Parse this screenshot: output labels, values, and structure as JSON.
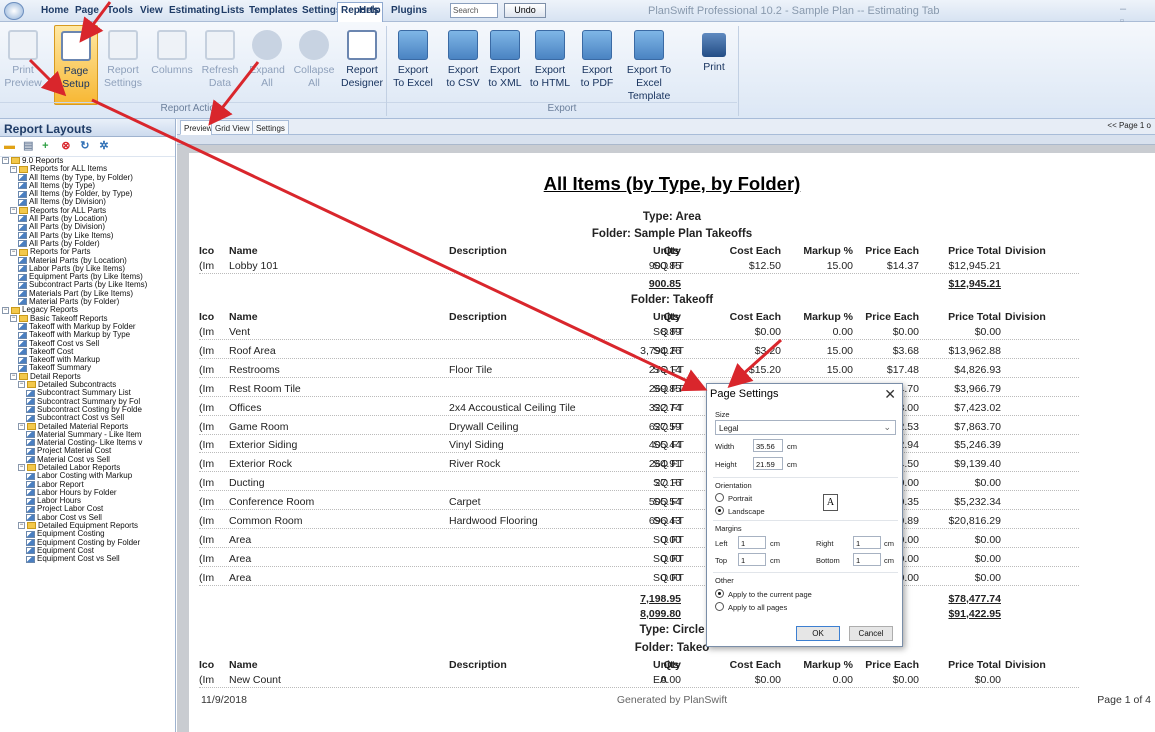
{
  "app": {
    "title": "PlanSwift Professional 10.2 - Sample Plan -- Estimating Tab",
    "search_placeholder": "Search",
    "undo": "Undo",
    "menus": [
      "Home",
      "Page",
      "Tools",
      "View",
      "Estimating",
      "Lists",
      "Templates",
      "Settings",
      "Reports",
      "Help",
      "Plugins"
    ],
    "active_menu": "Reports"
  },
  "ribbon": {
    "buttons": [
      {
        "l1": "Print",
        "l2": "Preview",
        "state": "disabled"
      },
      {
        "l1": "Page",
        "l2": "Setup",
        "state": "selected"
      },
      {
        "l1": "Report",
        "l2": "Settings",
        "state": "disabled"
      },
      {
        "l1": "Columns",
        "l2": "",
        "state": "disabled"
      },
      {
        "l1": "Refresh",
        "l2": "Data",
        "state": "disabled"
      },
      {
        "l1": "Expand",
        "l2": "All",
        "state": "disabled"
      },
      {
        "l1": "Collapse",
        "l2": "All",
        "state": "disabled"
      },
      {
        "l1": "Report",
        "l2": "Designer",
        "state": "enabled"
      },
      {
        "l1": "Export",
        "l2": "To Excel",
        "state": "enabled"
      },
      {
        "l1": "Export",
        "l2": "to CSV",
        "state": "enabled"
      },
      {
        "l1": "Export",
        "l2": "to XML",
        "state": "enabled"
      },
      {
        "l1": "Export",
        "l2": "to HTML",
        "state": "enabled"
      },
      {
        "l1": "Export",
        "l2": "to PDF",
        "state": "enabled"
      },
      {
        "l1": "Export To",
        "l2": "Excel Template",
        "state": "enabled"
      },
      {
        "l1": "Print",
        "l2": "",
        "state": "enabled"
      }
    ],
    "groups": {
      "actions": "Report Actions",
      "export": "Export"
    }
  },
  "left_panel": {
    "title": "Report Layouts",
    "tree": [
      {
        "t": "9.0 Reports",
        "d": 0,
        "k": "root"
      },
      {
        "t": "Reports for ALL Items",
        "d": 1,
        "k": "folder"
      },
      {
        "t": "All Items (by Type, by Folder)",
        "d": 2,
        "k": "rep"
      },
      {
        "t": "All Items (by Type)",
        "d": 2,
        "k": "rep"
      },
      {
        "t": "All Items (by Folder, by Type)",
        "d": 2,
        "k": "rep"
      },
      {
        "t": "All Items (by Division)",
        "d": 2,
        "k": "rep"
      },
      {
        "t": "Reports for ALL Parts",
        "d": 1,
        "k": "folder"
      },
      {
        "t": "All Parts (by Location)",
        "d": 2,
        "k": "rep"
      },
      {
        "t": "All Parts (by Division)",
        "d": 2,
        "k": "rep"
      },
      {
        "t": "All Parts (by Like Items)",
        "d": 2,
        "k": "rep"
      },
      {
        "t": "All Parts (by Folder)",
        "d": 2,
        "k": "rep"
      },
      {
        "t": "Reports for Parts",
        "d": 1,
        "k": "folder"
      },
      {
        "t": "Material Parts (by Location)",
        "d": 2,
        "k": "rep"
      },
      {
        "t": "Labor Parts (by Like Items)",
        "d": 2,
        "k": "rep"
      },
      {
        "t": "Equipment Parts (by Like Items)",
        "d": 2,
        "k": "rep"
      },
      {
        "t": "Subcontract Parts (by Like Items)",
        "d": 2,
        "k": "rep"
      },
      {
        "t": "Materials Part (by Like Items)",
        "d": 2,
        "k": "rep"
      },
      {
        "t": "Material Parts (by Folder)",
        "d": 2,
        "k": "rep"
      },
      {
        "t": "Legacy Reports",
        "d": 0,
        "k": "root"
      },
      {
        "t": "Basic Takeoff Reports",
        "d": 1,
        "k": "folder"
      },
      {
        "t": "Takeoff with Markup by Folder",
        "d": 2,
        "k": "rep"
      },
      {
        "t": "Takeoff with Markup by Type",
        "d": 2,
        "k": "rep"
      },
      {
        "t": "Takeoff Cost vs Sell",
        "d": 2,
        "k": "rep"
      },
      {
        "t": "Takeoff Cost",
        "d": 2,
        "k": "rep"
      },
      {
        "t": "Takeoff with Markup",
        "d": 2,
        "k": "rep"
      },
      {
        "t": "Takeoff Summary",
        "d": 2,
        "k": "rep"
      },
      {
        "t": "Detail Reports",
        "d": 1,
        "k": "folder"
      },
      {
        "t": "Detailed Subcontracts",
        "d": 2,
        "k": "folder"
      },
      {
        "t": "Subcontract Summary List",
        "d": 3,
        "k": "rep"
      },
      {
        "t": "Subcontract Summary by Fol",
        "d": 3,
        "k": "rep"
      },
      {
        "t": "Subcontract Costing by Folde",
        "d": 3,
        "k": "rep"
      },
      {
        "t": "Subcontract Cost vs Sell",
        "d": 3,
        "k": "rep"
      },
      {
        "t": "Detailed Material Reports",
        "d": 2,
        "k": "folder"
      },
      {
        "t": "Material Summary - Like Item",
        "d": 3,
        "k": "rep"
      },
      {
        "t": "Material Costing- Like Items v",
        "d": 3,
        "k": "rep"
      },
      {
        "t": "Project Material Cost",
        "d": 3,
        "k": "rep"
      },
      {
        "t": "Material Cost vs Sell",
        "d": 3,
        "k": "rep"
      },
      {
        "t": "Detailed Labor Reports",
        "d": 2,
        "k": "folder"
      },
      {
        "t": "Labor Costing with Markup",
        "d": 3,
        "k": "rep"
      },
      {
        "t": "Labor Report",
        "d": 3,
        "k": "rep"
      },
      {
        "t": "Labor Hours by Folder",
        "d": 3,
        "k": "rep"
      },
      {
        "t": "Labor Hours",
        "d": 3,
        "k": "rep"
      },
      {
        "t": "Project Labor Cost",
        "d": 3,
        "k": "rep"
      },
      {
        "t": "Labor Cost vs Sell",
        "d": 3,
        "k": "rep"
      },
      {
        "t": "Detailed Equipment Reports",
        "d": 2,
        "k": "folder"
      },
      {
        "t": "Equipment Costing",
        "d": 3,
        "k": "rep"
      },
      {
        "t": "Equipment Costing by Folder",
        "d": 3,
        "k": "rep"
      },
      {
        "t": "Equipment Cost",
        "d": 3,
        "k": "rep"
      },
      {
        "t": "Equipment Cost vs Sell",
        "d": 3,
        "k": "rep"
      }
    ]
  },
  "tabs": {
    "preview": "Preview",
    "grid": "Grid View",
    "settings": "Settings",
    "pager": "<<  Page 1 o"
  },
  "report": {
    "title": "All Items (by Type, by Folder)",
    "headers": [
      "Ico",
      "Name",
      "Description",
      "Qty",
      "Units",
      "Cost Each",
      "Markup %",
      "Price Each",
      "Price Total",
      "Division"
    ],
    "area_type": "Type: Area",
    "folder1": "Folder: Sample Plan Takeoffs",
    "rows1": [
      [
        "(Im",
        "Lobby 101",
        "",
        "900.85",
        "SQ FT",
        "$12.50",
        "15.00",
        "$14.37",
        "$12,945.21"
      ]
    ],
    "total1": "900.85",
    "total1_price": "$12,945.21",
    "folder2": "Folder: Takeoff",
    "rows2": [
      [
        "(Im",
        "Vent",
        "",
        "8.89",
        "SQ FT",
        "$0.00",
        "0.00",
        "$0.00",
        "$0.00"
      ],
      [
        "(Im",
        "Roof Area",
        "",
        "3,794.26",
        "SQ FT",
        "$3.20",
        "15.00",
        "$3.68",
        "$13,962.88"
      ],
      [
        "(Im",
        "Restrooms",
        "Floor Tile",
        "276.14",
        "SQ FT",
        "$15.20",
        "15.00",
        "$17.48",
        "$4,826.93"
      ],
      [
        "(Im",
        "Rest Room Tile",
        "",
        "269.85",
        "SQ FT",
        "",
        "",
        "$14.70",
        "$3,966.79"
      ],
      [
        "(Im",
        "Offices",
        "2x4 Accoustical Ceiling Tile",
        "322.74",
        "SQ FT",
        "",
        "",
        "$23.00",
        "$7,423.02"
      ],
      [
        "(Im",
        "Game Room",
        "Drywall Ceiling",
        "627.59",
        "SQ FT",
        "",
        "",
        "$12.53",
        "$7,863.70"
      ],
      [
        "(Im",
        "Exterior Siding",
        "Vinyl Siding",
        "405.44",
        "SQ FT",
        "",
        "",
        "$12.94",
        "$5,246.39"
      ],
      [
        "(Im",
        "Exterior Rock",
        "River Rock",
        "264.91",
        "SQ FT",
        "",
        "",
        "$34.50",
        "$9,139.40"
      ],
      [
        "(Im",
        "Ducting",
        "",
        "27.16",
        "SQ FT",
        "",
        "",
        "$0.00",
        "$0.00"
      ],
      [
        "(Im",
        "Conference Room",
        "Carpet",
        "505.54",
        "SQ FT",
        "",
        "",
        "$10.35",
        "$5,232.34"
      ],
      [
        "(Im",
        "Common Room",
        "Hardwood Flooring",
        "696.43",
        "SQ FT",
        "",
        "",
        "$29.89",
        "$20,816.29"
      ],
      [
        "(Im",
        "Area",
        "",
        "0.00",
        "SQ FT",
        "",
        "",
        "$0.00",
        "$0.00"
      ],
      [
        "(Im",
        "Area",
        "",
        "0.00",
        "SQ FT",
        "",
        "",
        "$0.00",
        "$0.00"
      ],
      [
        "(Im",
        "Area",
        "",
        "0.00",
        "SQ FT",
        "",
        "",
        "$0.00",
        "$0.00"
      ]
    ],
    "total2a": "7,198.95",
    "total2b": "8,099.80",
    "total2a_price": "$78,477.74",
    "total2b_price": "$91,422.95",
    "circle_type": "Type: Circle",
    "folder3": "Folder: Takeo",
    "rows3": [
      [
        "(Im",
        "New Count",
        "",
        "0.00",
        "EA",
        "$0.00",
        "0.00",
        "$0.00",
        "$0.00"
      ]
    ],
    "date": "11/9/2018",
    "generated": "Generated by PlanSwift",
    "page": "Page 1 of 4"
  },
  "dialog": {
    "title": "Page Settings",
    "size_label": "Size",
    "size_value": "Legal",
    "width_label": "Width",
    "width": "35.56",
    "height_label": "Height",
    "height": "21.59",
    "unit": "cm",
    "orientation_label": "Orientation",
    "portrait": "Portrait",
    "landscape": "Landscape",
    "orientation": "Landscape",
    "orient_glyph": "A",
    "margins_label": "Margins",
    "left_label": "Left",
    "left": "1",
    "right_label": "Right",
    "right": "1",
    "top_label": "Top",
    "top": "1",
    "bottom_label": "Bottom",
    "bottom": "1",
    "other_label": "Other",
    "apply_current": "Apply to the current page",
    "apply_all": "Apply to all pages",
    "ok": "OK",
    "cancel": "Cancel"
  },
  "colors": {
    "arrow": "#d9262c",
    "selected": "#f7b733"
  }
}
